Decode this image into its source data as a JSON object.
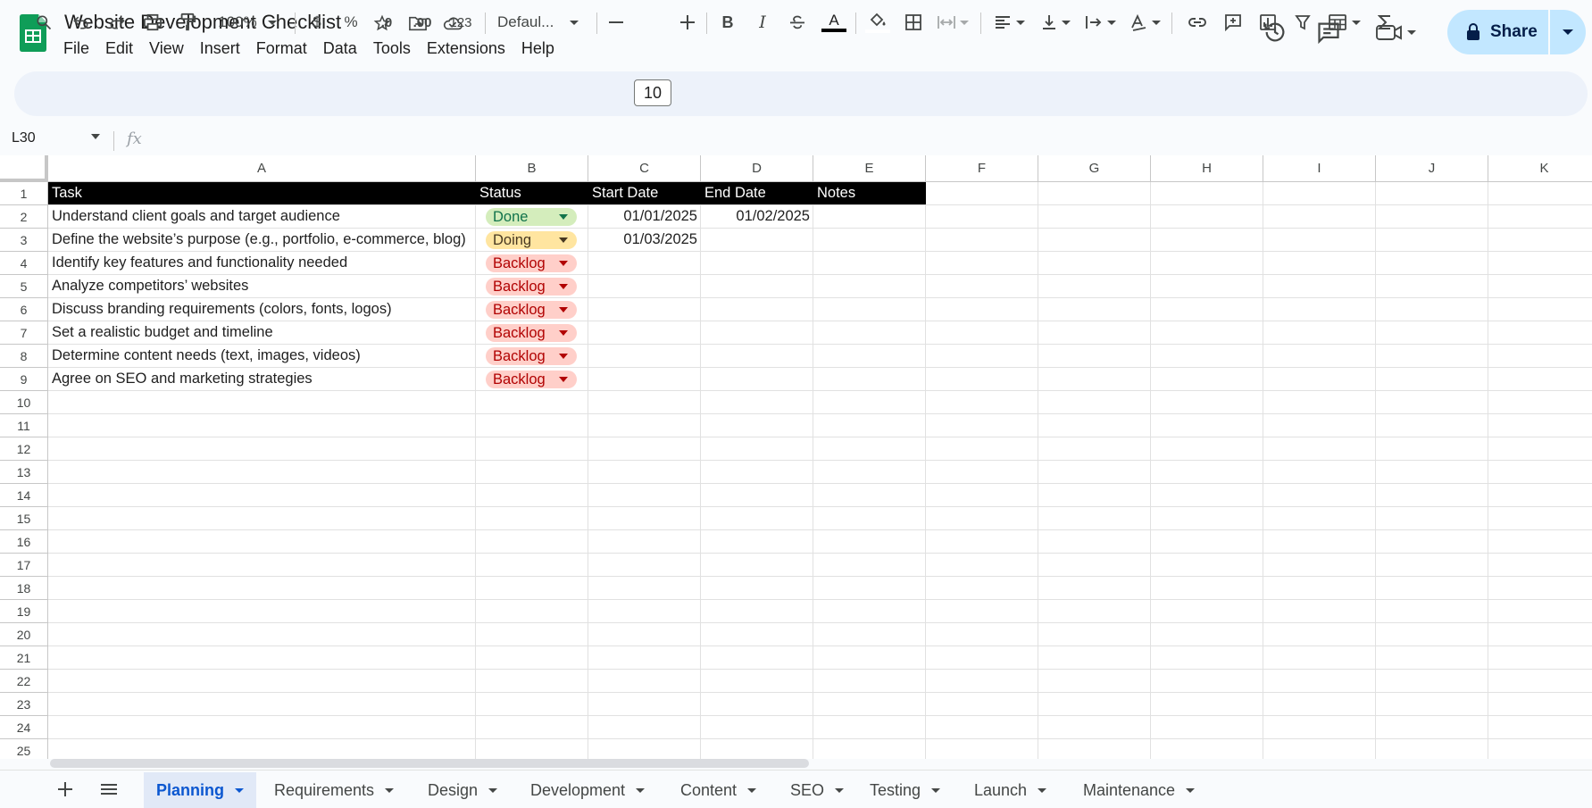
{
  "app": {
    "title": "Website Development Checklist",
    "menus": [
      "File",
      "Edit",
      "View",
      "Insert",
      "Format",
      "Data",
      "Tools",
      "Extensions",
      "Help"
    ],
    "share_label": "Share"
  },
  "toolbar": {
    "zoom": "100%",
    "currency": "$",
    "percent": "%",
    "decrease_decimal": ".0",
    "increase_decimal": ".00",
    "number_format": "123",
    "font": "Defaul...",
    "font_size": "10",
    "bold": "B",
    "italic": "I",
    "text_color": "A"
  },
  "formula_bar": {
    "cell_ref": "L30",
    "fx": "fx"
  },
  "grid": {
    "columns": [
      "A",
      "B",
      "C",
      "D",
      "E",
      "F",
      "G",
      "H",
      "I",
      "J",
      "K"
    ],
    "row_numbers": [
      "1",
      "2",
      "3",
      "4",
      "5",
      "6",
      "7",
      "8",
      "9",
      "10",
      "11",
      "12",
      "13",
      "14",
      "15",
      "16",
      "17",
      "18",
      "19",
      "20",
      "21",
      "22",
      "23",
      "24",
      "25"
    ],
    "header_row": [
      "Task",
      "Status",
      "Start Date",
      "End Date",
      "Notes"
    ],
    "rows": [
      {
        "task": "Understand client goals and target audience",
        "status": "Done",
        "start": "01/01/2025",
        "end": "01/02/2025"
      },
      {
        "task": "Define the website’s purpose (e.g., portfolio, e-commerce, blog)",
        "status": "Doing",
        "start": "01/03/2025",
        "end": ""
      },
      {
        "task": "Identify key features and functionality needed",
        "status": "Backlog",
        "start": "",
        "end": ""
      },
      {
        "task": "Analyze competitors’ websites",
        "status": "Backlog",
        "start": "",
        "end": ""
      },
      {
        "task": "Discuss branding requirements (colors, fonts, logos)",
        "status": "Backlog",
        "start": "",
        "end": ""
      },
      {
        "task": "Set a realistic budget and timeline",
        "status": "Backlog",
        "start": "",
        "end": ""
      },
      {
        "task": "Determine content needs (text, images, videos)",
        "status": "Backlog",
        "start": "",
        "end": ""
      },
      {
        "task": "Agree on SEO and marketing strategies",
        "status": "Backlog",
        "start": "",
        "end": ""
      }
    ],
    "status_colors": {
      "Done": {
        "bg": "#d4edbc",
        "fg": "#11734b"
      },
      "Doing": {
        "bg": "#ffe5a0",
        "fg": "#473821"
      },
      "Backlog": {
        "bg": "#ffcfc9",
        "fg": "#b10202"
      }
    }
  },
  "sheets": [
    "Planning",
    "Requirements",
    "Design",
    "Development",
    "Content",
    "SEO",
    "Testing",
    "Launch",
    "Maintenance"
  ],
  "active_sheet": "Planning",
  "colors": {
    "accent": "#0b57d0",
    "share_bg": "#c2e7ff",
    "toolbar_bg": "#edf2fa",
    "header_row_bg": "#000000"
  }
}
